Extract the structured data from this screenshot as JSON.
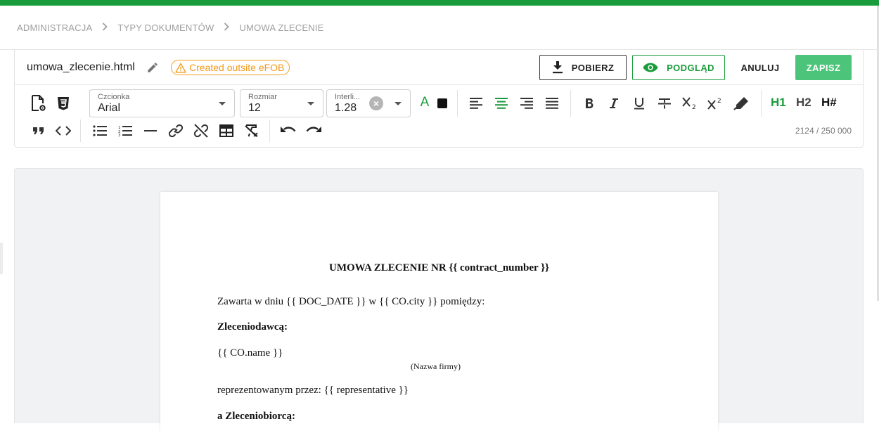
{
  "breadcrumb": {
    "items": [
      "ADMINISTRACJA",
      "TYPY DOKUMENTÓW",
      "UMOWA ZLECENIE"
    ],
    "separator": ">"
  },
  "header": {
    "filename": "umowa_zlecenie.html",
    "warning_badge": "Created outsite eFOB",
    "download_button": "POBIERZ",
    "preview_button": "PODGLĄD",
    "cancel_button": "ANULUJ",
    "save_button": "ZAPISZ"
  },
  "toolbar": {
    "font": {
      "label": "Czcionka",
      "value": "Arial"
    },
    "size": {
      "label": "Rozmiar",
      "value": "12"
    },
    "line_height": {
      "label": "Interli...",
      "value": "1.28"
    },
    "text_color_glyph": "A",
    "h1": "H1",
    "h2": "H2",
    "hcustom": "H#",
    "char_counter": "2124 / 250 000",
    "icons": [
      "document-settings-icon",
      "css3-icon",
      "text-color-icon",
      "background-color-icon",
      "align-left-icon",
      "align-center-icon",
      "align-right-icon",
      "align-justify-icon",
      "bold-icon",
      "italic-icon",
      "underline-icon",
      "strikethrough-icon",
      "subscript-icon",
      "superscript-icon",
      "highlighter-icon",
      "blockquote-icon",
      "code-icon",
      "bullet-list-icon",
      "numbered-list-icon",
      "horizontal-rule-icon",
      "link-icon",
      "unlink-icon",
      "table-icon",
      "clear-format-icon",
      "undo-icon",
      "redo-icon"
    ]
  },
  "document": {
    "title": "UMOWA ZLECENIE NR {{ contract_number }}",
    "line1": "Zawarta w dniu {{ DOC_DATE }} w {{ CO.city }} pomiędzy:",
    "principal_heading": "Zleceniodawcą:",
    "company_name": "{{ CO.name }}",
    "company_caption": "(Nazwa firmy)",
    "representative": "reprezentowanym przez: {{ representative }}",
    "contractor_heading": "a Zleceniobiorcą:"
  },
  "colors": {
    "brand_green": "#1a9c3c",
    "save_green": "#4cc57a",
    "warning_orange": "#f09a1a"
  }
}
